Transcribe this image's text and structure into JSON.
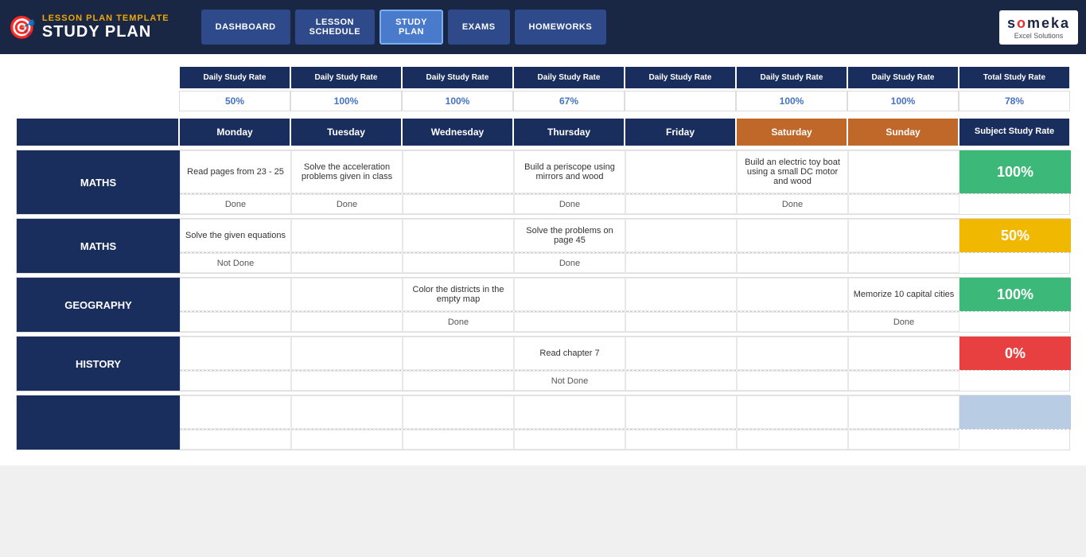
{
  "header": {
    "brand_subtitle": "LESSON PLAN TEMPLATE",
    "brand_title": "STUDY PLAN",
    "logo_icon": "🎯",
    "nav": [
      {
        "label": "DASHBOARD",
        "active": false
      },
      {
        "label": "LESSON\nSCHEDULE",
        "active": false
      },
      {
        "label": "STUDY\nPLAN",
        "active": true
      },
      {
        "label": "EXAMS",
        "active": false
      },
      {
        "label": "HOMEWORKS",
        "active": false
      }
    ],
    "logo_text": "someka",
    "logo_sub": "Excel Solutions"
  },
  "daily_rate_headers": [
    "Daily Study Rate",
    "Daily Study Rate",
    "Daily Study Rate",
    "Daily Study Rate",
    "Daily Study Rate",
    "Daily Study Rate",
    "Daily Study Rate",
    "Total Study Rate"
  ],
  "daily_rate_values": [
    "50%",
    "100%",
    "100%",
    "67%",
    "",
    "100%",
    "100%",
    "78%"
  ],
  "day_headers": [
    "Monday",
    "Tuesday",
    "Wednesday",
    "Thursday",
    "Friday",
    "Saturday",
    "Sunday",
    "Subject Study Rate"
  ],
  "subjects": [
    {
      "name": "MATHS",
      "tasks": [
        "Read pages from 23 - 25",
        "Solve the acceleration problems given in class",
        "",
        "Build a periscope using mirrors and wood",
        "",
        "Build an electric toy boat using a small DC motor and wood",
        ""
      ],
      "statuses": [
        "Done",
        "Done",
        "",
        "Done",
        "",
        "Done",
        ""
      ],
      "rate": "100%",
      "rate_class": "green"
    },
    {
      "name": "MATHS",
      "tasks": [
        "Solve the given equations",
        "",
        "",
        "Solve the problems on page 45",
        "",
        "",
        ""
      ],
      "statuses": [
        "Not Done",
        "",
        "",
        "Done",
        "",
        "",
        ""
      ],
      "rate": "50%",
      "rate_class": "yellow"
    },
    {
      "name": "GEOGRAPHY",
      "tasks": [
        "",
        "",
        "Color the districts in the empty map",
        "",
        "",
        "",
        "Memorize 10 capital cities"
      ],
      "statuses": [
        "",
        "",
        "Done",
        "",
        "",
        "",
        "Done"
      ],
      "rate": "100%",
      "rate_class": "green"
    },
    {
      "name": "HISTORY",
      "tasks": [
        "",
        "",
        "",
        "Read chapter 7",
        "",
        "",
        ""
      ],
      "statuses": [
        "",
        "",
        "",
        "Not Done",
        "",
        "",
        ""
      ],
      "rate": "0%",
      "rate_class": "red"
    },
    {
      "name": "",
      "tasks": [
        "",
        "",
        "",
        "",
        "",
        "",
        ""
      ],
      "statuses": [
        "",
        "",
        "",
        "",
        "",
        "",
        ""
      ],
      "rate": "",
      "rate_class": "lightblue"
    }
  ]
}
